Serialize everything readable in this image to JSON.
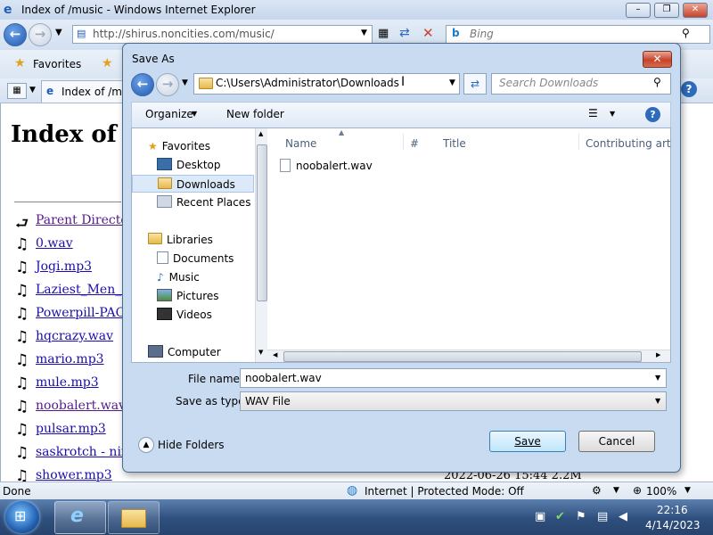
{
  "ie": {
    "window_title": "Index of /music - Windows Internet Explorer",
    "address": "http://shirus.noncities.com/music/",
    "search_placeholder": "Bing",
    "favorites_label": "Favorites",
    "tab_label": "Index of /mu",
    "page_heading": "Index of /",
    "listing": [
      {
        "name": "Parent Directory",
        "type": "parent"
      },
      {
        "name": "0.wav"
      },
      {
        "name": "Jogi.mp3"
      },
      {
        "name": "Laziest_Men_or"
      },
      {
        "name": "Powerpill-PAC-"
      },
      {
        "name": "hqcrazy.wav"
      },
      {
        "name": "mario.mp3"
      },
      {
        "name": "mule.mp3"
      },
      {
        "name": "noobalert.wav"
      },
      {
        "name": "pulsar.mp3"
      },
      {
        "name": "saskrotch - ninte"
      },
      {
        "name": "shower.mp3"
      }
    ],
    "partial_row_meta": "2022-06-26 15:44  2.2M",
    "status_left": "Done",
    "status_zone": "Internet | Protected Mode: Off",
    "zoom": "100%"
  },
  "dialog": {
    "title": "Save As",
    "path": "C:\\Users\\Administrator\\Downloads",
    "search_placeholder": "Search Downloads",
    "organize_label": "Organize",
    "new_folder_label": "New folder",
    "nav": {
      "favorites": "Favorites",
      "desktop": "Desktop",
      "downloads": "Downloads",
      "recent": "Recent Places",
      "libraries": "Libraries",
      "documents": "Documents",
      "music": "Music",
      "pictures": "Pictures",
      "videos": "Videos",
      "computer": "Computer"
    },
    "columns": [
      "Name",
      "#",
      "Title",
      "Contributing art"
    ],
    "files": [
      "noobalert.wav"
    ],
    "file_name_label": "File name:",
    "file_name_value": "noobalert.wav",
    "save_type_label": "Save as type:",
    "save_type_value": "WAV File",
    "hide_folders": "Hide Folders",
    "save_button": "Save",
    "cancel_button": "Cancel"
  },
  "taskbar": {
    "time": "22:16",
    "date": "4/14/2023"
  },
  "colors": {
    "ie_link": "#1a0dab",
    "ie_visited": "#551a8b",
    "dialog_frame": "#c9dbf0",
    "close_red": "#c7432b"
  }
}
